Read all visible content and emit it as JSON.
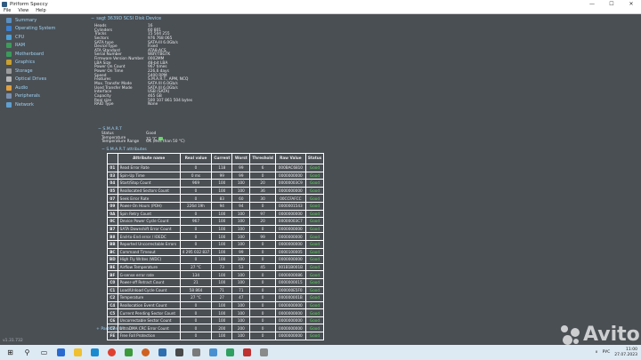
{
  "window": {
    "title": "Piriform Speccy",
    "minimize": "—",
    "maximize": "☐",
    "close": "✕"
  },
  "menu": [
    "File",
    "View",
    "Help"
  ],
  "sidebar": [
    {
      "label": "Summary",
      "color": "#5a8fc0"
    },
    {
      "label": "Operating System",
      "color": "#3a7fd0"
    },
    {
      "label": "CPU",
      "color": "#4aa0d8"
    },
    {
      "label": "RAM",
      "color": "#3c9c5a"
    },
    {
      "label": "Motherboard",
      "color": "#3a9a5a"
    },
    {
      "label": "Graphics",
      "color": "#c8a030"
    },
    {
      "label": "Storage",
      "color": "#9a9a9a"
    },
    {
      "label": "Optical Drives",
      "color": "#b5b5b5"
    },
    {
      "label": "Audio",
      "color": "#e0a040"
    },
    {
      "label": "Peripherals",
      "color": "#7a90b0"
    },
    {
      "label": "Network",
      "color": "#5fa0d0"
    }
  ],
  "device": {
    "header": "sagt 3639D SCSI Disk Device",
    "properties": [
      [
        "Heads",
        "16"
      ],
      [
        "Cylinders",
        "60 801"
      ],
      [
        "Tracks",
        "15 504 255"
      ],
      [
        "Sectors",
        "976 768 065"
      ],
      [
        "SATA type",
        "SATA-III 6.0Gb/s"
      ],
      [
        "Device type",
        "Fixed"
      ],
      [
        "ATA Standard",
        "ATA8-ACS"
      ],
      [
        "Serial Number",
        "WBY/TBGTK"
      ],
      [
        "Firmware Version Number",
        "0002MM"
      ],
      [
        "LBA Size",
        "48-bit LBA"
      ],
      [
        "Power On Count",
        "967 times"
      ],
      [
        "Power On Time",
        "226,6 days"
      ],
      [
        "Speed",
        "5400 RPM"
      ],
      [
        "Features",
        "S.M.A.R.T., APM, NCQ"
      ],
      [
        "Max. Transfer Mode",
        "SATA III 6.0Gb/s"
      ],
      [
        "Used Transfer Mode",
        "SATA III 6.0Gb/s"
      ],
      [
        "Interface",
        "USB (SATA)"
      ],
      [
        "Capacity",
        "465 GB"
      ],
      [
        "Real size",
        "500 107 861 504 bytes"
      ],
      [
        "RAID Type",
        "None"
      ]
    ]
  },
  "smart": {
    "header": "S.M.A.R.T",
    "status_label": "Status",
    "status_value": "Good",
    "temp_label": "Temperature",
    "temp_value": "31 °C",
    "range_label": "Temperature Range",
    "range_value": "OK (less than 50 °C)",
    "attributes_header": "S.M.A.R.T attributes",
    "columns": [
      "",
      "Attribute name",
      "Real value",
      "Current",
      "Worst",
      "Threshold",
      "Raw Value",
      "Status"
    ],
    "rows": [
      [
        "01",
        "Read Error Rate",
        "0",
        "118",
        "99",
        "6",
        "000BAC6810",
        "Good"
      ],
      [
        "03",
        "Spin-Up Time",
        "0 ms",
        "99",
        "99",
        "0",
        "0000000000",
        "Good"
      ],
      [
        "04",
        "Start/Stop Count",
        "969",
        "100",
        "100",
        "20",
        "00000003C9",
        "Good"
      ],
      [
        "05",
        "Reallocated Sectors Count",
        "0",
        "100",
        "100",
        "36",
        "0000000000",
        "Good"
      ],
      [
        "07",
        "Seek Error Rate",
        "0",
        "83",
        "60",
        "30",
        "00CCFAFCC",
        "Good"
      ],
      [
        "09",
        "Power-On Hours (POH)",
        "226d 19h",
        "94",
        "94",
        "0",
        "0000001543",
        "Good"
      ],
      [
        "0A",
        "Spin Retry Count",
        "0",
        "100",
        "100",
        "97",
        "0000000000",
        "Good"
      ],
      [
        "0C",
        "Device Power Cycle Count",
        "967",
        "100",
        "100",
        "20",
        "00000003C7",
        "Good"
      ],
      [
        "B7",
        "SATA Downshift Error Count",
        "0",
        "100",
        "100",
        "0",
        "0000000000",
        "Good"
      ],
      [
        "B8",
        "End-to-End error / IOEDC",
        "0",
        "100",
        "100",
        "99",
        "0000000000",
        "Good"
      ],
      [
        "BB",
        "Reported Uncorrectable Errors",
        "0",
        "100",
        "100",
        "0",
        "0000000000",
        "Good"
      ],
      [
        "BC",
        "Command Timeout",
        "4 295 032 837",
        "100",
        "99",
        "0",
        "0000100005",
        "Good"
      ],
      [
        "BD",
        "High Fly Writes (WDC)",
        "0",
        "100",
        "100",
        "0",
        "0000000000",
        "Good"
      ],
      [
        "BE",
        "Airflow Temperature",
        "27 °C",
        "73",
        "53",
        "45",
        "001B1B001B",
        "Good"
      ],
      [
        "BF",
        "G-sense error rate",
        "134",
        "100",
        "100",
        "0",
        "0000000086",
        "Good"
      ],
      [
        "C0",
        "Power-off Retract Count",
        "21",
        "100",
        "100",
        "0",
        "0000000015",
        "Good"
      ],
      [
        "C1",
        "Load/Unload Cycle Count",
        "58 864",
        "71",
        "71",
        "0",
        "000000E5F0",
        "Good"
      ],
      [
        "C2",
        "Temperature",
        "27 °C",
        "27",
        "47",
        "0",
        "000000001B",
        "Good"
      ],
      [
        "C4",
        "Reallocation Event Count",
        "0",
        "100",
        "100",
        "0",
        "0000000000",
        "Good"
      ],
      [
        "C5",
        "Current Pending Sector Count",
        "0",
        "100",
        "100",
        "0",
        "0000000000",
        "Good"
      ],
      [
        "C6",
        "Uncorrectable Sector Count",
        "0",
        "100",
        "100",
        "0",
        "0000000000",
        "Good"
      ],
      [
        "C7",
        "UltraDMA CRC Error Count",
        "0",
        "200",
        "200",
        "0",
        "0000000000",
        "Good"
      ],
      [
        "FE",
        "Free Fall Protection",
        "0",
        "100",
        "100",
        "0",
        "0000000000",
        "Good"
      ]
    ]
  },
  "partition": "Partition 0",
  "version": "v1.31.732",
  "watermark": "Avito",
  "taskbar": {
    "lang": "РУС",
    "time": "11:00",
    "date": "27.07.2023",
    "apps": [
      "#2a6ad0",
      "#f0c030",
      "#1a8ad0",
      "#e04030",
      "#3a9a3a",
      "#d06020",
      "#2f6fb0",
      "#4a4a4a",
      "#7a7a7a",
      "#4a90d0",
      "#30a060",
      "#c03030",
      "#8a8a8a"
    ]
  }
}
